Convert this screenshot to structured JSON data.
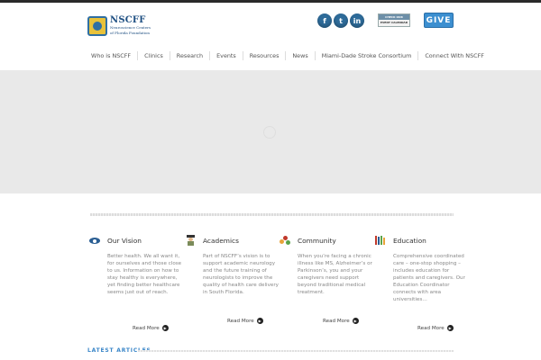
{
  "header": {
    "logo_name": "NSCFF",
    "logo_sub": [
      "Neuroscience Centers",
      "of Florida Foundation"
    ],
    "social": [
      {
        "icon": "facebook-icon",
        "glyph": "f"
      },
      {
        "icon": "twitter-icon",
        "glyph": "t"
      },
      {
        "icon": "linkedin-icon",
        "glyph": "in"
      }
    ],
    "calendar_top": "CHECK OUR",
    "calendar_bottom": "EVENT CALENDAR",
    "give_label": "GIVE"
  },
  "nav": {
    "items": [
      "Who is NSCFF",
      "Clinics",
      "Research",
      "Events",
      "Resources",
      "News",
      "Miami-Dade Stroke Consortium",
      "Connect With NSCFF"
    ]
  },
  "columns": [
    {
      "icon": "eye-icon",
      "title": "Our Vision",
      "body": "Better health. We all want it, for ourselves and those close to us. Information on how to stay healthy is everywhere, yet finding better healthcare seems just out of reach.",
      "read_more": "Read More"
    },
    {
      "icon": "graduate-icon",
      "title": "Academics",
      "body": "Part of NSCFF’s vision is to support academic neurology and the future training of neurologists to improve the quality of health care delivery in South Florida.",
      "read_more": "Read More"
    },
    {
      "icon": "community-icon",
      "title": "Community",
      "body": "When you’re facing a chronic illness like MS, Alzheimer’s or Parkinson’s, you and your caregivers need support beyond traditional medical treatment.",
      "read_more": "Read More"
    },
    {
      "icon": "books-icon",
      "title": "Education",
      "body": "Comprehensive coordinated care – one-stop shopping – includes education for patients and caregivers. Our Education Coordinator connects with area universities…",
      "read_more": "Read More"
    }
  ],
  "latest_articles": "LATEST ARTICLES",
  "colors": {
    "accent": "#3a86c8",
    "brand": "#1e4f82",
    "give": "#3c8fd0"
  }
}
